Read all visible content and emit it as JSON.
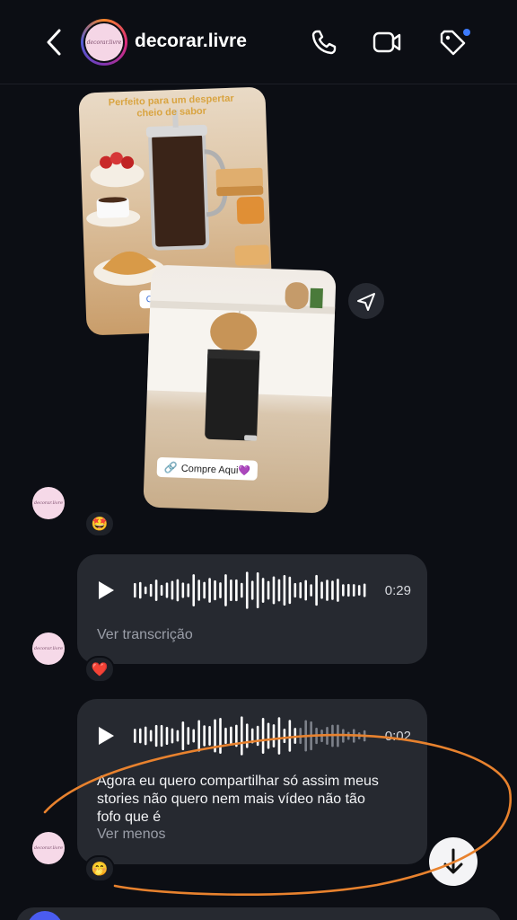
{
  "header": {
    "title": "decorar.livre",
    "avatar_text": "decorar.livre"
  },
  "post1": {
    "headline": "Perfeito para um despertar cheio de sabor",
    "cta": "C"
  },
  "post2": {
    "cta": "Compre Aqui💜"
  },
  "reactions": {
    "first": "🤩",
    "second": "❤️",
    "third": "🤭"
  },
  "voice1": {
    "duration": "0:29",
    "transcription_link": "Ver transcrição",
    "progress": 0
  },
  "voice2": {
    "duration": "0:02",
    "transcript": "Agora eu quero compartilhar só assim meus stories não quero nem mais vídeo não tão fofo que é",
    "less_link": "Ver menos",
    "progress": 0.7
  },
  "colors": {
    "background": "#0c0e14",
    "bubble": "#262930",
    "annotation": "#e8822e",
    "notification_dot": "#3d7bfd"
  }
}
